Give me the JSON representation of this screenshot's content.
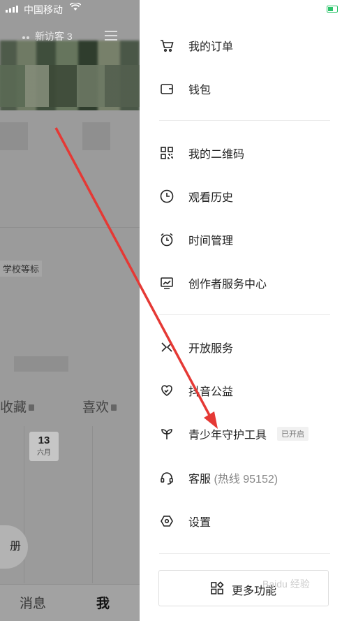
{
  "status_bar": {
    "carrier": "中国移动"
  },
  "left_panel": {
    "visitors": "新访客 3",
    "tag_text": "学校等标",
    "tabs": [
      "收藏",
      "喜欢"
    ],
    "date": {
      "day": "13",
      "month": "六月"
    },
    "pill_text": "册",
    "bottom_nav": [
      "消息",
      "我"
    ]
  },
  "drawer": {
    "items": [
      {
        "label": "我的订单",
        "icon": "cart-icon"
      },
      {
        "label": "钱包",
        "icon": "wallet-icon"
      },
      {
        "label": "我的二维码",
        "icon": "qrcode-icon"
      },
      {
        "label": "观看历史",
        "icon": "clock-icon"
      },
      {
        "label": "时间管理",
        "icon": "alarm-icon"
      },
      {
        "label": "创作者服务中心",
        "icon": "chart-icon"
      },
      {
        "label": "开放服务",
        "icon": "open-service-icon"
      },
      {
        "label": "抖音公益",
        "icon": "charity-heart-icon"
      },
      {
        "label": "青少年守护工具",
        "icon": "sprout-icon",
        "badge": "已开启"
      },
      {
        "label": "客服",
        "sublabel": "(热线 95152)",
        "icon": "headset-icon"
      },
      {
        "label": "设置",
        "icon": "settings-icon"
      }
    ],
    "more_label": "更多功能",
    "watermark": "Baidu 经验"
  },
  "colors": {
    "arrow": "#e53935",
    "battery": "#2bc46a"
  }
}
